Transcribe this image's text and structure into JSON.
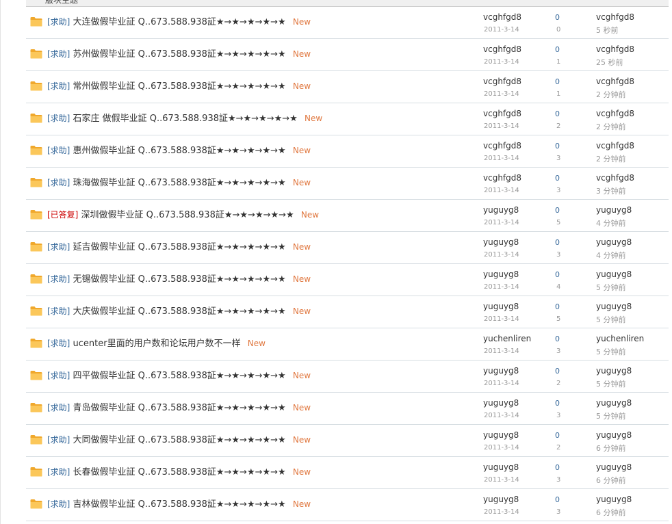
{
  "header": {
    "title": "版块主题"
  },
  "threads": [
    {
      "type": "[求助]",
      "answered": false,
      "subject": "大连做假毕业証  Q..673.588.938証★→★→★→★→★",
      "badge": "New",
      "author": "vcghfgd8",
      "date": "2011-3-14",
      "replies": "0",
      "views": "0",
      "last_user": "vcghfgd8",
      "last_time": "5 秒前"
    },
    {
      "type": "[求助]",
      "answered": false,
      "subject": "苏州做假毕业証  Q..673.588.938証★→★→★→★→★",
      "badge": "New",
      "author": "vcghfgd8",
      "date": "2011-3-14",
      "replies": "0",
      "views": "1",
      "last_user": "vcghfgd8",
      "last_time": "25 秒前"
    },
    {
      "type": "[求助]",
      "answered": false,
      "subject": "常州做假毕业証  Q..673.588.938証★→★→★→★→★",
      "badge": "New",
      "author": "vcghfgd8",
      "date": "2011-3-14",
      "replies": "0",
      "views": "1",
      "last_user": "vcghfgd8",
      "last_time": "2 分钟前"
    },
    {
      "type": "[求助]",
      "answered": false,
      "subject": "石家庄  做假毕业証  Q..673.588.938証★→★→★→★→★",
      "badge": "New",
      "author": "vcghfgd8",
      "date": "2011-3-14",
      "replies": "0",
      "views": "2",
      "last_user": "vcghfgd8",
      "last_time": "2 分钟前"
    },
    {
      "type": "[求助]",
      "answered": false,
      "subject": "惠州做假毕业証  Q..673.588.938証★→★→★→★→★",
      "badge": "New",
      "author": "vcghfgd8",
      "date": "2011-3-14",
      "replies": "0",
      "views": "3",
      "last_user": "vcghfgd8",
      "last_time": "2 分钟前"
    },
    {
      "type": "[求助]",
      "answered": false,
      "subject": "珠海做假毕业証  Q..673.588.938証★→★→★→★→★",
      "badge": "New",
      "author": "vcghfgd8",
      "date": "2011-3-14",
      "replies": "0",
      "views": "3",
      "last_user": "vcghfgd8",
      "last_time": "3 分钟前"
    },
    {
      "type": "[已答复]",
      "answered": true,
      "subject": "深圳做假毕业証  Q..673.588.938証★→★→★→★→★",
      "badge": "New",
      "author": "yuguyg8",
      "date": "2011-3-14",
      "replies": "0",
      "views": "5",
      "last_user": "yuguyg8",
      "last_time": "4 分钟前"
    },
    {
      "type": "[求助]",
      "answered": false,
      "subject": "延吉做假毕业証  Q..673.588.938証★→★→★→★→★",
      "badge": "New",
      "author": "yuguyg8",
      "date": "2011-3-14",
      "replies": "0",
      "views": "3",
      "last_user": "yuguyg8",
      "last_time": "4 分钟前"
    },
    {
      "type": "[求助]",
      "answered": false,
      "subject": "无锡做假毕业証  Q..673.588.938証★→★→★→★→★",
      "badge": "New",
      "author": "yuguyg8",
      "date": "2011-3-14",
      "replies": "0",
      "views": "4",
      "last_user": "yuguyg8",
      "last_time": "5 分钟前"
    },
    {
      "type": "[求助]",
      "answered": false,
      "subject": "大庆做假毕业証  Q..673.588.938証★→★→★→★→★",
      "badge": "New",
      "author": "yuguyg8",
      "date": "2011-3-14",
      "replies": "0",
      "views": "5",
      "last_user": "yuguyg8",
      "last_time": "5 分钟前"
    },
    {
      "type": "[求助]",
      "answered": false,
      "subject": "ucenter里面的用户数和论坛用户数不一样",
      "badge": "New",
      "author": "yuchenliren",
      "date": "2011-3-14",
      "replies": "0",
      "views": "3",
      "last_user": "yuchenliren",
      "last_time": "5 分钟前"
    },
    {
      "type": "[求助]",
      "answered": false,
      "subject": "四平做假毕业証  Q..673.588.938証★→★→★→★→★",
      "badge": "New",
      "author": "yuguyg8",
      "date": "2011-3-14",
      "replies": "0",
      "views": "2",
      "last_user": "yuguyg8",
      "last_time": "5 分钟前"
    },
    {
      "type": "[求助]",
      "answered": false,
      "subject": "青岛做假毕业証  Q..673.588.938証★→★→★→★→★",
      "badge": "New",
      "author": "yuguyg8",
      "date": "2011-3-14",
      "replies": "0",
      "views": "3",
      "last_user": "yuguyg8",
      "last_time": "5 分钟前"
    },
    {
      "type": "[求助]",
      "answered": false,
      "subject": "大同做假毕业証  Q..673.588.938証★→★→★→★→★",
      "badge": "New",
      "author": "yuguyg8",
      "date": "2011-3-14",
      "replies": "0",
      "views": "2",
      "last_user": "yuguyg8",
      "last_time": "6 分钟前"
    },
    {
      "type": "[求助]",
      "answered": false,
      "subject": "长春做假毕业証  Q..673.588.938証★→★→★→★→★",
      "badge": "New",
      "author": "yuguyg8",
      "date": "2011-3-14",
      "replies": "0",
      "views": "3",
      "last_user": "yuguyg8",
      "last_time": "6 分钟前"
    },
    {
      "type": "[求助]",
      "answered": false,
      "subject": "吉林做假毕业証  Q..673.588.938証★→★→★→★→★",
      "badge": "New",
      "author": "yuguyg8",
      "date": "2011-3-14",
      "replies": "0",
      "views": "3",
      "last_user": "yuguyg8",
      "last_time": "6 分钟前"
    }
  ],
  "icons": {
    "thread": "folder-icon"
  },
  "colors": {
    "type_tag": "#336699",
    "answered_tag": "#cc0000",
    "new_badge": "#e07840",
    "folder": "#f5b93c",
    "row_border": "#d6dde2"
  }
}
